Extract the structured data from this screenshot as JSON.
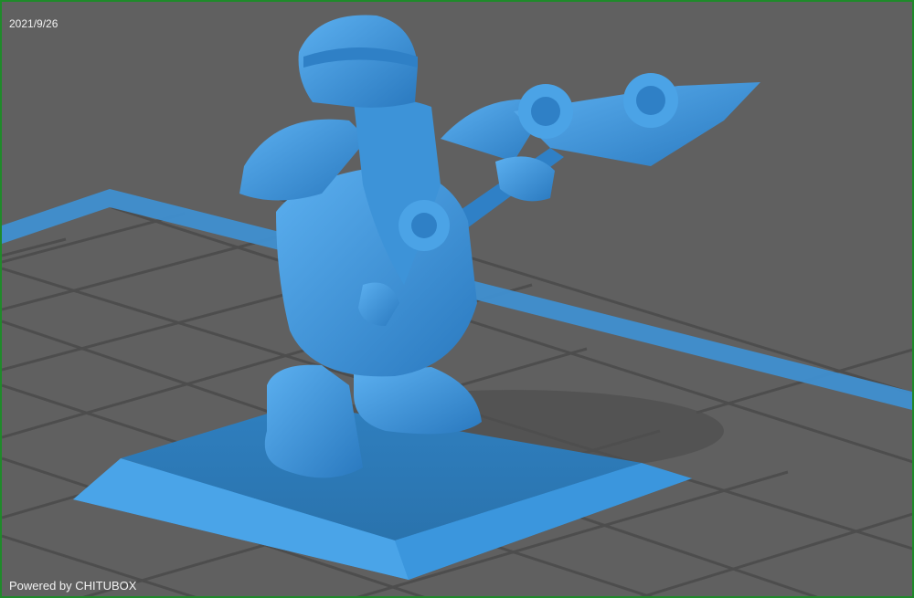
{
  "overlay": {
    "date": "2021/9/26",
    "powered_by": "Powered by CHITUBOX"
  },
  "viewport": {
    "background_color": "#606060",
    "border_color": "#1f8a2a",
    "grid_color": "#4e4e4e",
    "plate_edge_color": "#3a8ccf",
    "model_color": "#3a8fd4"
  },
  "model": {
    "subject": "dwarf warrior miniature with double-bladed axe on square base"
  }
}
